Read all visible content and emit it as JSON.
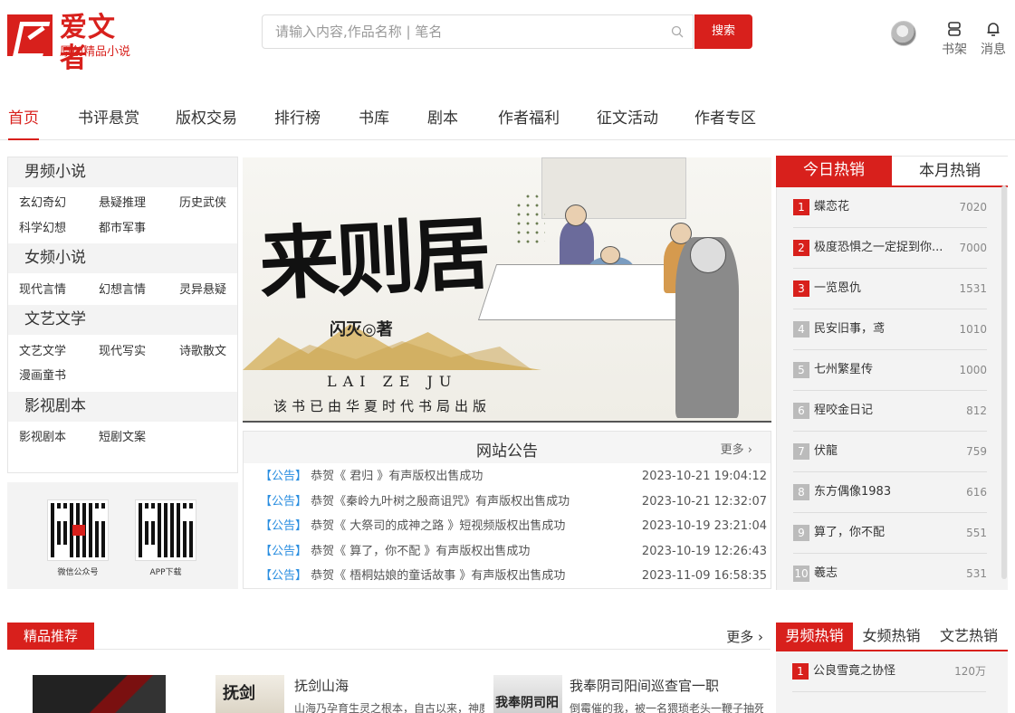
{
  "brand": {
    "name": "爱文者",
    "slogan": "原创精品小说",
    "color": "#d8201c"
  },
  "search": {
    "placeholder": "请输入内容,作品名称 | 笔名",
    "button": "搜索"
  },
  "header": {
    "shelf": "书架",
    "messages": "消息"
  },
  "nav": [
    "首页",
    "书评悬赏",
    "版权交易",
    "排行榜",
    "书库",
    "剧本",
    "作者福利",
    "征文活动",
    "作者专区"
  ],
  "categories": [
    {
      "title": "男频小说",
      "links": [
        "玄幻奇幻",
        "悬疑推理",
        "历史武侠",
        "科学幻想",
        "都市军事"
      ]
    },
    {
      "title": "女频小说",
      "links": [
        "现代言情",
        "幻想言情",
        "灵异悬疑"
      ]
    },
    {
      "title": "文艺文学",
      "links": [
        "文艺文学",
        "现代写实",
        "诗歌散文",
        "漫画童书"
      ]
    },
    {
      "title": "影视剧本",
      "links": [
        "影视剧本",
        "短剧文案"
      ]
    }
  ],
  "qr": {
    "wechat": "微信公众号",
    "app": "APP下载"
  },
  "banner": {
    "title": "来则居",
    "author": "闪灭◎著",
    "pinyin": "LAI ZE JU",
    "publisher": "该书已由华夏时代书局出版"
  },
  "notice": {
    "title": "网站公告",
    "more": "更多",
    "items": [
      {
        "tag": "【公告】",
        "text": "恭贺《 君归 》有声版权出售成功",
        "date": "2023-10-21 19:04:12"
      },
      {
        "tag": "【公告】",
        "text": "恭贺《秦岭九叶树之殷商诅咒》有声版权出售成功",
        "date": "2023-10-21 12:32:07"
      },
      {
        "tag": "【公告】",
        "text": "恭贺《 大祭司的成神之路 》短视频版权出售成功",
        "date": "2023-10-19 23:21:04"
      },
      {
        "tag": "【公告】",
        "text": "恭贺《 算了，你不配 》有声版权出售成功",
        "date": "2023-10-19 12:26:43"
      },
      {
        "tag": "【公告】",
        "text": "恭贺《 梧桐姑娘的童话故事 》有声版权出售成功",
        "date": "2023-11-09 16:58:35"
      }
    ]
  },
  "ranking": {
    "tabs": [
      "今日热销",
      "本月热销"
    ],
    "items": [
      {
        "num": "1",
        "name": "蝶恋花",
        "value": "7020"
      },
      {
        "num": "2",
        "name": "极度恐惧之一定捉到你...",
        "value": "7000"
      },
      {
        "num": "3",
        "name": "一览恩仇",
        "value": "1531"
      },
      {
        "num": "4",
        "name": "民安旧事，鸢",
        "value": "1010"
      },
      {
        "num": "5",
        "name": "七州繁星传",
        "value": "1000"
      },
      {
        "num": "6",
        "name": "程咬金日记",
        "value": "812"
      },
      {
        "num": "7",
        "name": "伏龍",
        "value": "759"
      },
      {
        "num": "8",
        "name": "东方偶像1983",
        "value": "616"
      },
      {
        "num": "9",
        "name": "算了，你不配",
        "value": "551"
      },
      {
        "num": "10",
        "name": "羲志",
        "value": "531"
      }
    ]
  },
  "featured": {
    "tab": "精品推荐",
    "more": "更多",
    "books": [
      {
        "title": "抚剑山海",
        "desc": "山海乃孕育生灵之根本，自古以来，神魔志",
        "cover": "抚剑"
      },
      {
        "title": "我奉阴司阳间巡查官一职",
        "desc": "倒霉催的我，被一名猥琐老头一鞭子抽死在",
        "cover": "我奉阴司阳间"
      }
    ]
  },
  "ranking2": {
    "tabs": [
      "男频热销",
      "女频热销",
      "文艺热销"
    ],
    "items": [
      {
        "num": "1",
        "name": "公良雪竟之协怪",
        "value": "120万"
      }
    ]
  }
}
